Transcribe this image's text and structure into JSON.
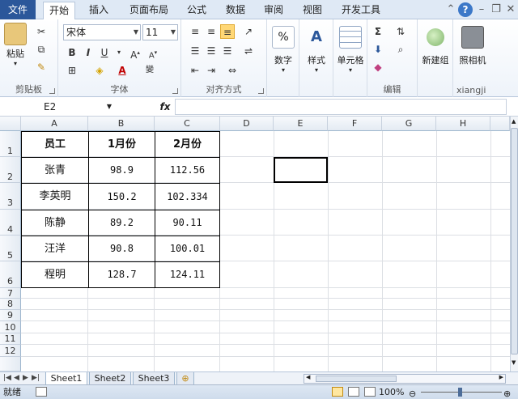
{
  "tabs": {
    "file": "文件",
    "home": "开始",
    "insert": "插入",
    "layout": "页面布局",
    "formulas": "公式",
    "data": "数据",
    "review": "审阅",
    "view": "视图",
    "developer": "开发工具"
  },
  "ribbon": {
    "clipboard": {
      "paste": "粘贴",
      "title": "剪贴板"
    },
    "font": {
      "name": "宋体",
      "size": "11",
      "title": "字体"
    },
    "alignment": {
      "title": "对齐方式"
    },
    "number": {
      "label": "数字"
    },
    "styles": {
      "label": "样式"
    },
    "cells": {
      "label": "单元格"
    },
    "editing": {
      "title": "编辑"
    },
    "newgroup": {
      "label": "新建组"
    },
    "camera": {
      "label": "照相机",
      "title": "xiangji"
    }
  },
  "formula_bar": {
    "name_box": "E2",
    "fx": "fx",
    "content": ""
  },
  "columns": [
    "A",
    "B",
    "C",
    "D",
    "E",
    "F",
    "G",
    "H"
  ],
  "rows": [
    "1",
    "2",
    "3",
    "4",
    "5",
    "6",
    "7",
    "8",
    "9",
    "10",
    "11",
    "12"
  ],
  "table": {
    "headers": [
      "员工",
      "1月份",
      "2月份"
    ],
    "rows": [
      [
        "张青",
        "98.9",
        "112.56"
      ],
      [
        "李英明",
        "150.2",
        "102.334"
      ],
      [
        "陈静",
        "89.2",
        "90.11"
      ],
      [
        "汪洋",
        "90.8",
        "100.01"
      ],
      [
        "程明",
        "128.7",
        "124.11"
      ]
    ]
  },
  "sheets": [
    "Sheet1",
    "Sheet2",
    "Sheet3"
  ],
  "status": {
    "ready": "就绪",
    "zoom": "100%"
  },
  "colors": {
    "file_tab": "#2b579a",
    "ribbon_bg": "#dfe9f5"
  }
}
